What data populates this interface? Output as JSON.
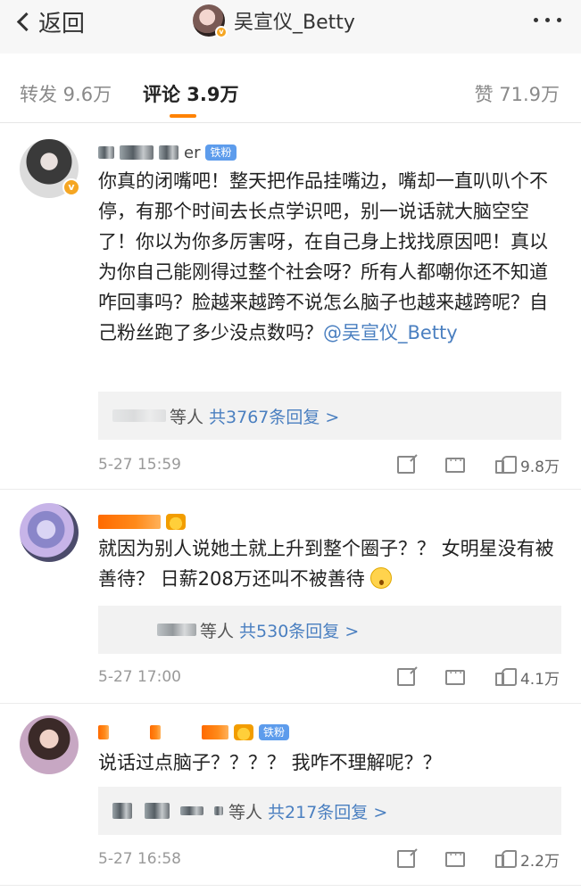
{
  "nav": {
    "back_label": "返回",
    "title": "吴宣仪_Betty"
  },
  "tabs": {
    "repost": "转发 9.6万",
    "comment": "评论 3.9万",
    "like": "赞 71.9万",
    "accent_color": "#ff8200"
  },
  "comments": [
    {
      "username_suffix": "er",
      "badge": "铁粉",
      "text": "你真的闭嘴吧！整天把作品挂嘴边，嘴却一直叭叭个不停，有那个时间去长点学识吧，别一说话就大脑空空了！你以为你多厉害呀，在自己身上找找原因吧！真以为你自己能刚得过整个社会呀？所有人都嘲你还不知道咋回事吗？脸越来越跨不说怎么脑子也越来越跨呢？自己粉丝跑了多少没点数吗？",
      "mention": "@吴宣仪_Betty",
      "reply_users": "等人",
      "reply_count": "共3767条回复 >",
      "time": "5-27 15:59",
      "likes": "9.8万"
    },
    {
      "text": "就因为别人说她土就上升到整个圈子？？ 女明星没有被善待？ 日薪208万还叫不被善待",
      "reply_users": "等人",
      "reply_count": "共530条回复 >",
      "time": "5-27 17:00",
      "likes": "4.1万"
    },
    {
      "badge": "铁粉",
      "text": "说话过点脑子？？？？ 我咋不理解呢？？",
      "reply_users": "等人",
      "reply_count": "共217条回复 >",
      "time": "5-27 16:58",
      "likes": "2.2万"
    }
  ]
}
